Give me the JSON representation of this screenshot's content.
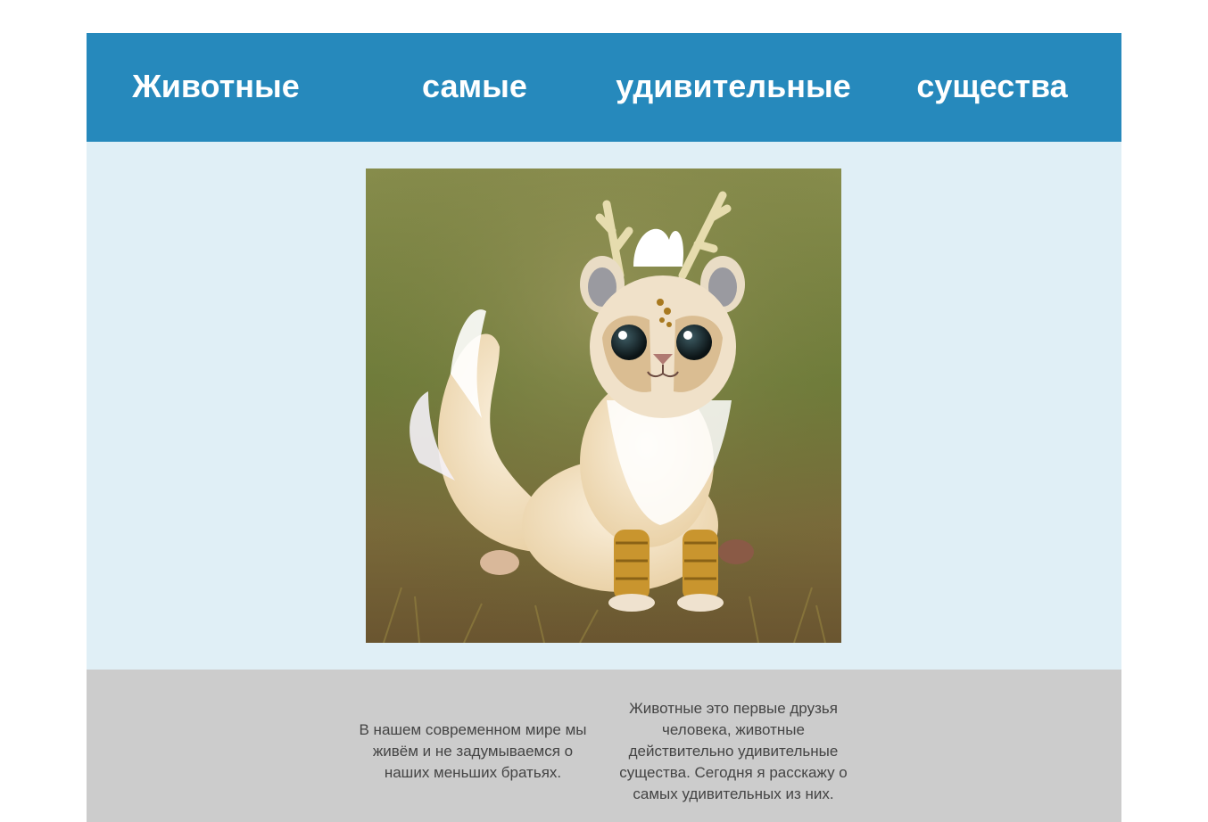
{
  "header": {
    "words": [
      "Животные",
      "самые",
      "удивительные",
      "существа"
    ]
  },
  "hero": {
    "image_icon": "fantasy-creature-photo"
  },
  "footer": {
    "column_1": "В нашем современном мире мы живём и не задумываемся о наших меньших братьях.",
    "column_2": "Животные это первые друзья человека, животные действительно удивительные существа. Сегодня я расскажу о самых удивительных из них."
  },
  "colors": {
    "header_bg": "#2689bc",
    "hero_bg": "#e0eff6",
    "footer_bg": "#cccccc",
    "text": "#444444"
  }
}
